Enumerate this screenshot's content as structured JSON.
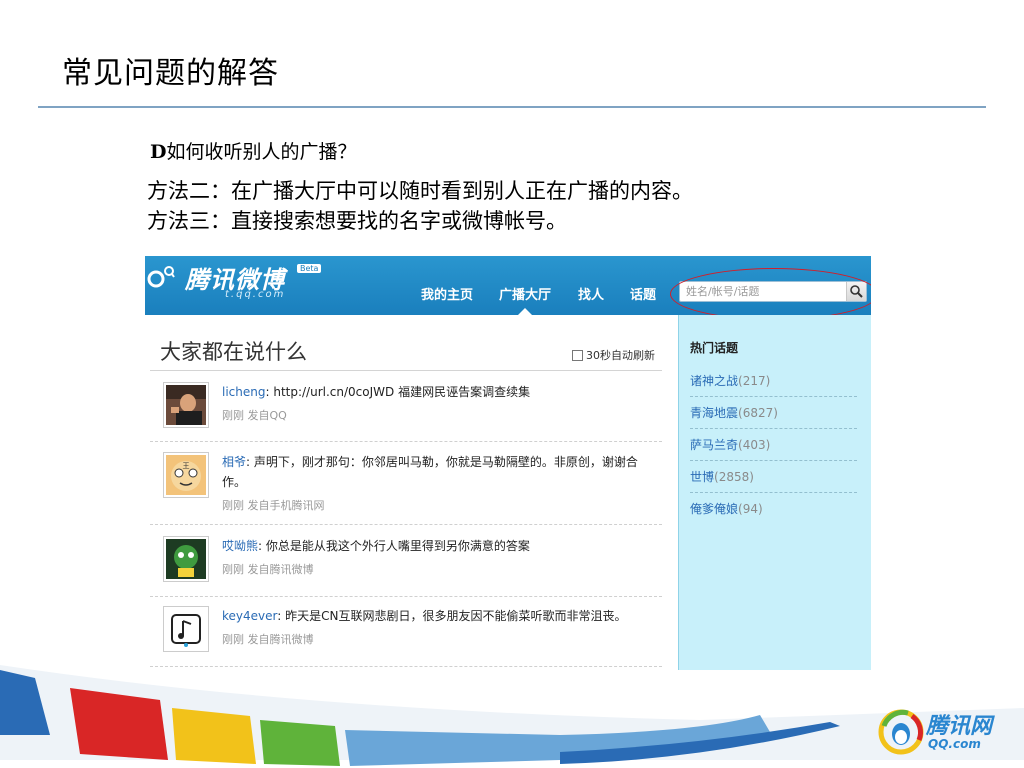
{
  "slide": {
    "title": "常见问题的解答",
    "question_prefix": "D",
    "question_text": "如何收听别人的广播？",
    "method2": "方法二：在广播大厅中可以随时看到别人正在广播的内容。",
    "method3": "方法三：直接搜索想要找的名字或微博帐号。"
  },
  "weibo": {
    "logo_text": "腾讯微博",
    "beta": "Beta",
    "domain": "t.qq.com",
    "nav": [
      "我的主页",
      "广播大厅",
      "找人",
      "话题"
    ],
    "search_placeholder": "姓名/帐号/话题",
    "feed_title": "大家都在说什么",
    "auto_refresh": "30秒自动刷新",
    "posts": [
      {
        "user": "licheng",
        "text": ": http://url.cn/0coJWD 福建网民诬告案调查续集",
        "meta": "刚刚 发自QQ"
      },
      {
        "user": "相爷",
        "text": ": 声明下，刚才那句：你邻居叫马勒，你就是马勒隔壁的。非原创，谢谢合作。",
        "meta": "刚刚 发自手机腾讯网"
      },
      {
        "user": "哎呦熊",
        "text": ": 你总是能从我这个外行人嘴里得到另你满意的答案",
        "meta": "刚刚 发自腾讯微博"
      },
      {
        "user": "key4ever",
        "text": ": 昨天是CN互联网悲剧日，很多朋友因不能偷菜听歌而非常沮丧。",
        "meta": "刚刚 发自腾讯微博"
      }
    ],
    "side_title": "热门话题",
    "topics": [
      {
        "name": "诸神之战",
        "count": "(217)"
      },
      {
        "name": "青海地震",
        "count": "(6827)"
      },
      {
        "name": "萨马兰奇",
        "count": "(403)"
      },
      {
        "name": "世博",
        "count": "(2858)"
      },
      {
        "name": "俺爹俺娘",
        "count": "(94)"
      }
    ]
  },
  "brand": {
    "name": "腾讯网",
    "domain": "QQ.com"
  },
  "colors": {
    "accent_blue": "#1a7fbd",
    "sidebar_bg": "#c8f0fa",
    "highlight_red": "#d01f2a",
    "link_blue": "#2a6bb5"
  }
}
